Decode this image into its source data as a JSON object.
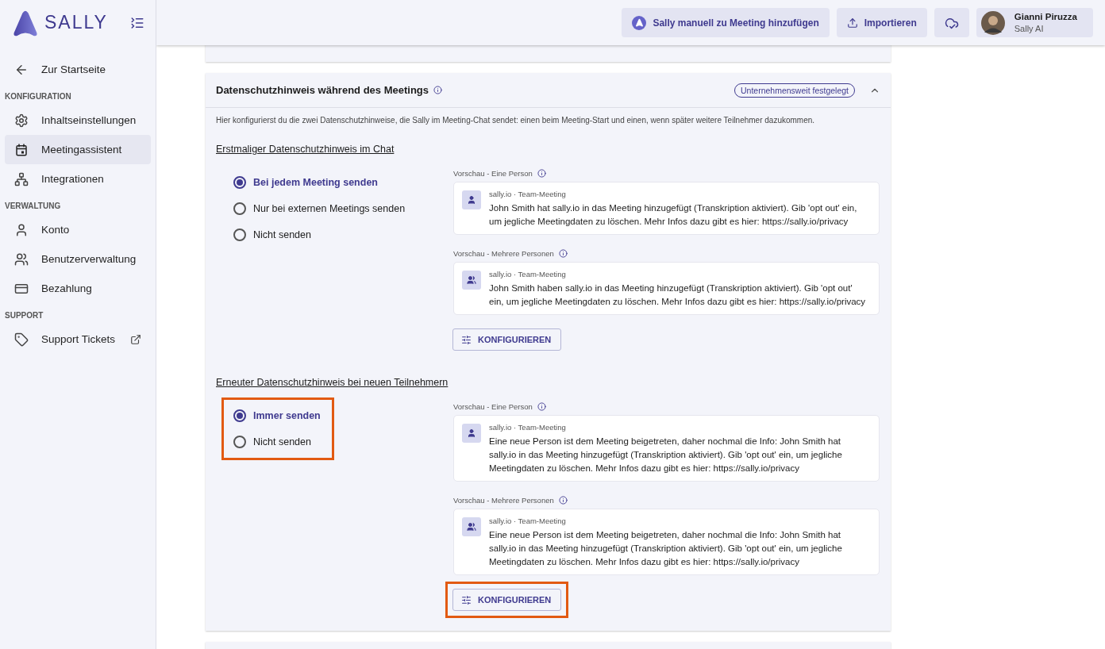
{
  "sidebar": {
    "brand": "SALLY",
    "back": "Zur Startseite",
    "sections": [
      {
        "title": "KONFIGURATION",
        "items": [
          {
            "label": "Inhaltseinstellungen",
            "selected": false,
            "external": false
          },
          {
            "label": "Meetingassistent",
            "selected": true,
            "external": false
          },
          {
            "label": "Integrationen",
            "selected": false,
            "external": false
          }
        ]
      },
      {
        "title": "VERWALTUNG",
        "items": [
          {
            "label": "Konto",
            "selected": false,
            "external": false
          },
          {
            "label": "Benutzerverwaltung",
            "selected": false,
            "external": false
          },
          {
            "label": "Bezahlung",
            "selected": false,
            "external": false
          }
        ]
      },
      {
        "title": "SUPPORT",
        "items": [
          {
            "label": "Support Tickets",
            "selected": false,
            "external": true
          }
        ]
      }
    ]
  },
  "topbar": {
    "buttons": [
      {
        "label": "Sally manuell zu Meeting hinzufügen"
      },
      {
        "label": "Importieren"
      }
    ],
    "user": {
      "name": "Gianni Piruzza",
      "subtitle": "Sally AI"
    }
  },
  "panels": [
    {
      "expanded": false
    },
    {
      "title": "Datenschutzhinweis während des Meetings",
      "badge": "Unternehmensweit festgelegt",
      "expanded": true,
      "description": "Hier konfigurierst du die zwei Datenschutzhinweise, die Sally im Meeting-Chat sendet: einen beim Meeting-Start und einen, wenn später weitere Teilnehmer dazukommen.",
      "sections": [
        {
          "title": "Erstmaliger Datenschutzhinweis im Chat",
          "options_highlighted": false,
          "options": [
            {
              "label": "Bei jedem Meeting senden",
              "selected": true
            },
            {
              "label": "Nur bei externen Meetings senden",
              "selected": false
            },
            {
              "label": "Nicht senden",
              "selected": false
            }
          ],
          "previews": [
            {
              "label": "Vorschau - Eine Person",
              "kind": "single",
              "sender": "sally.io · Team-Meeting",
              "message": "John Smith hat sally.io in das Meeting hinzugefügt (Transkription aktiviert). Gib 'opt out' ein, um jegliche Meetingdaten zu löschen. Mehr Infos dazu gibt es hier: https://sally.io/privacy"
            },
            {
              "label": "Vorschau - Mehrere Personen",
              "kind": "group",
              "sender": "sally.io · Team-Meeting",
              "message": "John Smith haben sally.io in das Meeting hinzugefügt (Transkription aktiviert). Gib 'opt out' ein, um jegliche Meetingdaten zu löschen. Mehr Infos dazu gibt es hier: https://sally.io/privacy"
            }
          ],
          "button": {
            "label": "KONFIGURIEREN",
            "highlighted": false
          }
        },
        {
          "title": "Erneuter Datenschutzhinweis bei neuen Teilnehmern",
          "options_highlighted": true,
          "options": [
            {
              "label": "Immer senden",
              "selected": true
            },
            {
              "label": "Nicht senden",
              "selected": false
            }
          ],
          "previews": [
            {
              "label": "Vorschau - Eine Person",
              "kind": "single",
              "sender": "sally.io · Team-Meeting",
              "message": "Eine neue Person ist dem Meeting beigetreten, daher nochmal die Info:  John Smith hat sally.io in das Meeting hinzugefügt (Transkription aktiviert). Gib 'opt out' ein, um jegliche Meetingdaten zu löschen. Mehr Infos dazu gibt es hier: https://sally.io/privacy"
            },
            {
              "label": "Vorschau - Mehrere Personen",
              "kind": "group",
              "sender": "sally.io · Team-Meeting",
              "message": "Eine neue Person ist dem Meeting beigetreten, daher nochmal die Info:  John Smith hat sally.io in das Meeting hinzugefügt (Transkription aktiviert). Gib 'opt out' ein, um jegliche Meetingdaten zu löschen. Mehr Infos dazu gibt es hier: https://sally.io/privacy"
            }
          ],
          "button": {
            "label": "KONFIGURIEREN",
            "highlighted": true
          }
        }
      ]
    },
    {
      "expanded": false
    }
  ]
}
